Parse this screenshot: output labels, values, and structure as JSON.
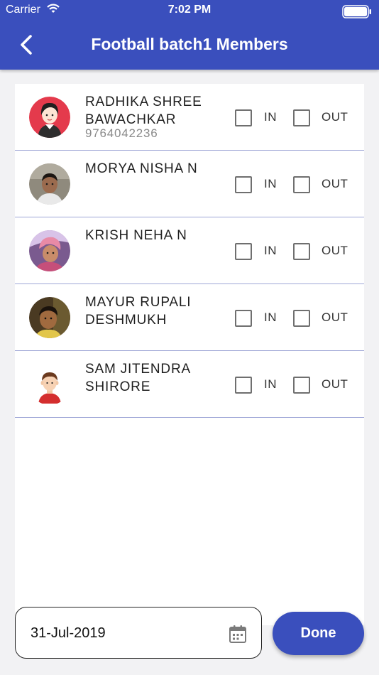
{
  "status_bar": {
    "carrier": "Carrier",
    "time": "7:02 PM"
  },
  "header": {
    "title": "Football batch1 Members"
  },
  "members": [
    {
      "name": "RADHIKA SHREE BAWACHKAR",
      "phone": "9764042236",
      "avatar": "cartoon-girl-avatar"
    },
    {
      "name": "MORYA NISHA N",
      "phone": "",
      "avatar": "boy-photo-avatar"
    },
    {
      "name": "KRISH NEHA N",
      "phone": "",
      "avatar": "child-photo-avatar"
    },
    {
      "name": "MAYUR RUPALI DESHMUKH",
      "phone": "",
      "avatar": "boy-photo-avatar"
    },
    {
      "name": "SAM JITENDRA SHIRORE",
      "phone": "",
      "avatar": "cartoon-boy-avatar"
    }
  ],
  "attendance_labels": {
    "in": "IN",
    "out": "OUT"
  },
  "footer": {
    "date": "31-Jul-2019",
    "done_label": "Done"
  },
  "colors": {
    "primary": "#3a4fbd",
    "divider": "#9ea6d6"
  }
}
